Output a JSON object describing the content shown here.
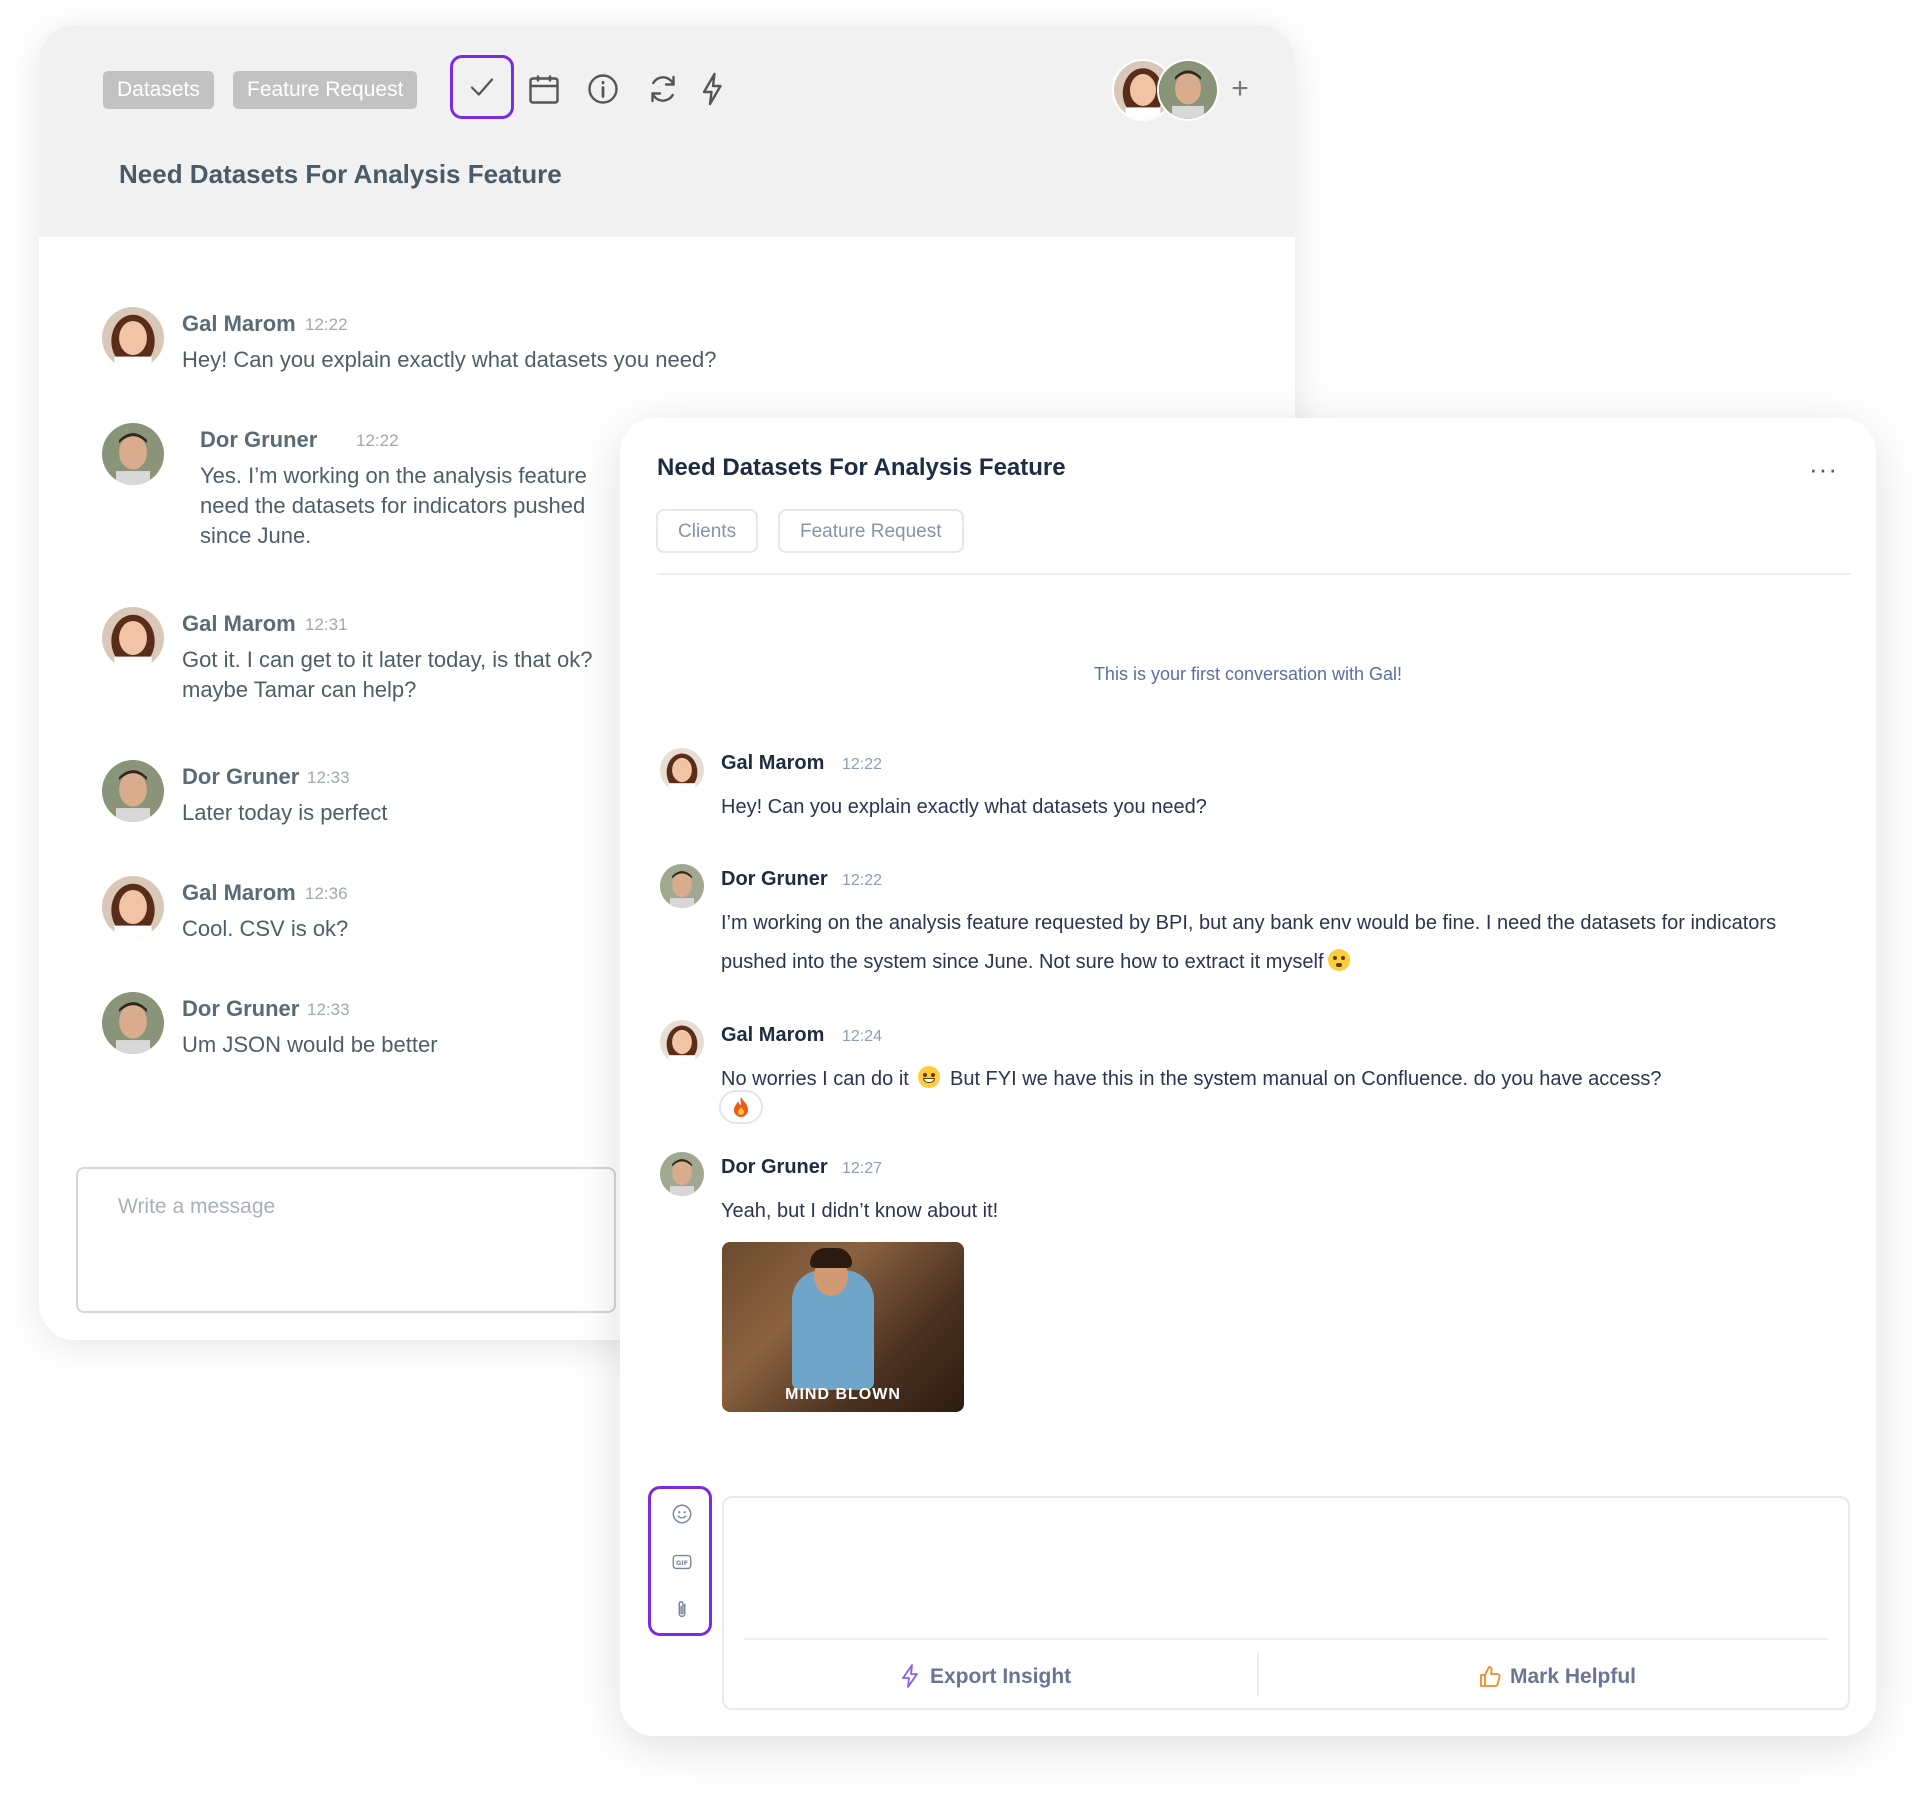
{
  "back_panel": {
    "tags": [
      "Datasets",
      "Feature Request"
    ],
    "title": "Need Datasets For Analysis Feature",
    "messages": [
      {
        "author": "Gal Marom",
        "time": "12:22",
        "text": "Hey! Can you explain exactly what datasets you need?"
      },
      {
        "author": "Dor Gruner",
        "time": "12:22",
        "text": "Yes. I’m working on the analysis feature need the datasets for indicators pushed since June."
      },
      {
        "author": "Gal Marom",
        "time": "12:31",
        "text": "Got it. I can get to it later today, is that ok? maybe Tamar can help?"
      },
      {
        "author": "Dor Gruner",
        "time": "12:33",
        "text": "Later today is perfect"
      },
      {
        "author": "Gal Marom",
        "time": "12:36",
        "text": "Cool. CSV is ok?"
      },
      {
        "author": "Dor Gruner",
        "time": "12:33",
        "text": "Um JSON would be better"
      }
    ],
    "input_placeholder": "Write a message"
  },
  "front_panel": {
    "title": "Need Datasets For Analysis Feature",
    "more_label": "···",
    "tags": [
      "Clients",
      "Feature Request"
    ],
    "first_note": "This is your first conversation with Gal!",
    "messages": [
      {
        "author": "Gal Marom",
        "time": "12:22",
        "text": "Hey! Can you explain exactly what datasets you need?"
      },
      {
        "author": "Dor Gruner",
        "time": "12:22",
        "text": "I’m working on the analysis feature requested by BPI, but any bank env would be fine. I need the datasets for indicators pushed into the system since June. Not sure how to extract it myself"
      },
      {
        "author": "Gal Marom",
        "time": "12:24",
        "text_a": "No worries I can do it",
        "text_b": "But FYI we have this in the system manual on Confluence. do you have access?"
      },
      {
        "author": "Dor Gruner",
        "time": "12:27",
        "text": "Yeah, but I didn’t know about it!"
      }
    ],
    "gif_caption": "MIND BLOWN",
    "actions": {
      "export": "Export Insight",
      "helpful": "Mark Helpful"
    }
  },
  "colors": {
    "accent": "#7d2be0",
    "helpful": "#f08a24",
    "export": "#8b5cf6"
  }
}
